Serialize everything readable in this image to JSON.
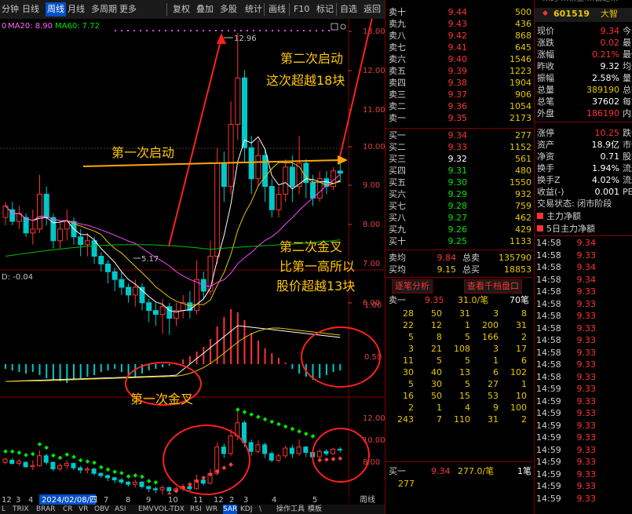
{
  "toolbar": {
    "items": [
      "分钟",
      "日线",
      "周线",
      "月线",
      "多周期",
      "更多",
      "复权",
      "叠加",
      "多股",
      "统计",
      "画线",
      "F10",
      "标记",
      "自选",
      "返回"
    ],
    "active_index": 2
  },
  "chart": {
    "ma_legend": {
      "ma20": "MA20: 8.90",
      "ma60": "MA60: 7.72",
      "prefix": "0"
    },
    "macd_legend": "D: -0.04",
    "price_axis": [
      "13.00",
      "12.00",
      "11.00",
      "10.00",
      "9.00",
      "8.00",
      "7.00",
      "6.00"
    ],
    "macd_axis": [
      "1.00",
      "0.50"
    ],
    "sar_axis": [
      "12.00",
      "10.00",
      "8.00"
    ],
    "high_label": "12.96",
    "low_label": "5.17",
    "date_label": "2024/02/08/四",
    "x_ticks": [
      "12",
      "3",
      "4",
      "5",
      "6",
      "7",
      "8",
      "9",
      "10",
      "11",
      "12",
      "2",
      "3",
      "4",
      "5"
    ],
    "period_label": "周线",
    "annotations": {
      "second_start_1": "第二次启动",
      "second_start_2": "这次超越18块",
      "first_start": "第一次启动",
      "second_cross_1": "第二次金叉",
      "second_cross_2": "比第一高所以",
      "second_cross_3": "股价超越13块",
      "first_cross": "第一次金叉"
    }
  },
  "indicator_tabs": [
    "L",
    "TRIX",
    "BRAR",
    "CR",
    "VR",
    "OBV",
    "ASI",
    "EMV",
    "VOL-TDX",
    "RSI",
    "WR",
    "SAR",
    "KDJ",
    "\\",
    "操作工具",
    "模板"
  ],
  "order_book": {
    "sells": [
      {
        "label": "卖十",
        "price": "9.44",
        "vol": "500"
      },
      {
        "label": "卖九",
        "price": "9.43",
        "vol": "436"
      },
      {
        "label": "卖八",
        "price": "9.42",
        "vol": "868"
      },
      {
        "label": "卖七",
        "price": "9.41",
        "vol": "645"
      },
      {
        "label": "卖六",
        "price": "9.40",
        "vol": "1546"
      },
      {
        "label": "卖五",
        "price": "9.39",
        "vol": "1223"
      },
      {
        "label": "卖四",
        "price": "9.38",
        "vol": "1904"
      },
      {
        "label": "卖三",
        "price": "9.37",
        "vol": "906"
      },
      {
        "label": "卖二",
        "price": "9.36",
        "vol": "1054"
      },
      {
        "label": "卖一",
        "price": "9.35",
        "vol": "2173"
      }
    ],
    "buys": [
      {
        "label": "买一",
        "price": "9.34",
        "vol": "277"
      },
      {
        "label": "买二",
        "price": "9.33",
        "vol": "1152"
      },
      {
        "label": "买三",
        "price": "9.32",
        "vol": "561"
      },
      {
        "label": "买四",
        "price": "9.31",
        "vol": "480"
      },
      {
        "label": "买五",
        "price": "9.30",
        "vol": "1550"
      },
      {
        "label": "买六",
        "price": "9.29",
        "vol": "932"
      },
      {
        "label": "买七",
        "price": "9.28",
        "vol": "759"
      },
      {
        "label": "买八",
        "price": "9.27",
        "vol": "462"
      },
      {
        "label": "买九",
        "price": "9.26",
        "vol": "429"
      },
      {
        "label": "买十",
        "price": "9.25",
        "vol": "1133"
      }
    ],
    "avg": [
      {
        "label": "卖均",
        "price": "9.84",
        "tlabel": "总卖",
        "vol": "135790"
      },
      {
        "label": "买均",
        "price": "9.15",
        "tlabel": "总买",
        "vol": "18853"
      }
    ],
    "tabs": [
      "逐笔分析",
      "查看千档盘口"
    ],
    "sell1_detail": {
      "label": "卖一",
      "price": "9.35",
      "qty": "31.0/笔",
      "count": "70笔"
    },
    "queue": [
      [
        "28",
        "50",
        "31",
        "3",
        "8"
      ],
      [
        "22",
        "12",
        "1",
        "200",
        "31"
      ],
      [
        "5",
        "8",
        "5",
        "166",
        "2"
      ],
      [
        "3",
        "21",
        "108",
        "3",
        "17"
      ],
      [
        "11",
        "5",
        "5",
        "1",
        "6"
      ],
      [
        "30",
        "40",
        "13",
        "6",
        "102"
      ],
      [
        "5",
        "30",
        "5",
        "27",
        "1"
      ],
      [
        "16",
        "50",
        "15",
        "53",
        "10"
      ],
      [
        "2",
        "1",
        "4",
        "9",
        "100"
      ],
      [
        "243",
        "7",
        "110",
        "31",
        "2"
      ]
    ],
    "buy1_detail": {
      "label": "买一",
      "price": "9.34",
      "qty": "277.0/笔",
      "count": "1笔"
    },
    "buy1_queue": "277"
  },
  "info": {
    "header_top": "…跨  …新生  …自选…",
    "code": "601519",
    "name": "大智",
    "rows": [
      {
        "l": "现价",
        "v": "9.34",
        "c": "red",
        "x": "今开"
      },
      {
        "l": "涨跌",
        "v": "0.02",
        "c": "red",
        "x": "最高"
      },
      {
        "l": "涨幅",
        "v": "0.21%",
        "c": "red",
        "x": "最低"
      },
      {
        "l": "昨收",
        "v": "9.32",
        "c": "wht",
        "x": "均价"
      },
      {
        "l": "振幅",
        "v": "2.58%",
        "c": "wht",
        "x": "量比"
      },
      {
        "l": "总量",
        "v": "389190",
        "c": "yel",
        "x": "总额"
      },
      {
        "l": "总笔",
        "v": "37602",
        "c": "wht",
        "x": "每笔"
      },
      {
        "l": "外盘",
        "v": "186190",
        "c": "red",
        "x": "内盘"
      }
    ],
    "rows2": [
      {
        "l": "涨停",
        "v": "10.25",
        "c": "red",
        "x": "跌停"
      },
      {
        "l": "资产",
        "v": "18.9亿",
        "c": "wht",
        "x": "市值"
      },
      {
        "l": "净资",
        "v": "0.71",
        "c": "wht",
        "x": "股本"
      },
      {
        "l": "换手",
        "v": "1.94%",
        "c": "wht",
        "x": "流通"
      },
      {
        "l": "换手Z",
        "v": "4.02%",
        "c": "wht",
        "x": "流通"
      },
      {
        "l": "收益(-)",
        "v": "0.001",
        "c": "wht",
        "x": "PE(动)"
      }
    ],
    "trade_status": "交易状态: 闭市阶段",
    "main_net": "主力净额",
    "main_net5": "5日主力净额",
    "ticks": [
      {
        "t": "14:58",
        "p": "9.34"
      },
      {
        "t": "14:58",
        "p": "9.33"
      },
      {
        "t": "14:58",
        "p": "9.34"
      },
      {
        "t": "14:58",
        "p": "9.34"
      },
      {
        "t": "14:58",
        "p": "9.33"
      },
      {
        "t": "14:58",
        "p": "9.33"
      },
      {
        "t": "14:58",
        "p": "9.33"
      },
      {
        "t": "14:58",
        "p": "9.33"
      },
      {
        "t": "14:58",
        "p": "9.33"
      },
      {
        "t": "14:58",
        "p": "9.33"
      },
      {
        "t": "14:58",
        "p": "9.33"
      },
      {
        "t": "14:58",
        "p": "9.33"
      },
      {
        "t": "14:59",
        "p": "9.33"
      },
      {
        "t": "14:59",
        "p": "9.33"
      },
      {
        "t": "14:59",
        "p": "9.33"
      },
      {
        "t": "14:59",
        "p": "9.33"
      },
      {
        "t": "14:59",
        "p": "9.33"
      },
      {
        "t": "14:59",
        "p": "9.33"
      },
      {
        "t": "14:59",
        "p": "9.33"
      },
      {
        "t": "14:59",
        "p": "9.33"
      },
      {
        "t": "14:59",
        "p": "9.33"
      },
      {
        "t": "14:59",
        "p": "9.33"
      }
    ],
    "colors": {
      "up": "#ff3232",
      "down": "#00e600",
      "accent": "#0050c8",
      "frame": "#800000"
    }
  }
}
